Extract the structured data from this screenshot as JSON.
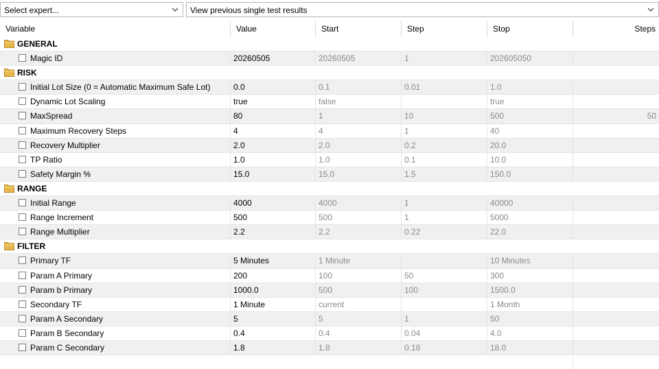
{
  "toolbar": {
    "expert_select": "Select expert...",
    "results_select": "View previous single test results"
  },
  "columns": [
    "Variable",
    "Value",
    "Start",
    "Step",
    "Stop",
    "Steps"
  ],
  "groups": [
    {
      "title": "GENERAL",
      "rows": [
        {
          "name": "Magic ID",
          "value": "20260505",
          "start": "20260505",
          "step": "1",
          "stop": "202605050",
          "steps": ""
        }
      ]
    },
    {
      "title": "RISK",
      "rows": [
        {
          "name": "Initial Lot Size (0 = Automatic Maximum Safe Lot)",
          "value": "0.0",
          "start": "0.1",
          "step": "0.01",
          "stop": "1.0",
          "steps": ""
        },
        {
          "name": "Dynamic Lot Scaling",
          "value": "true",
          "start": "false",
          "step": "",
          "stop": "true",
          "steps": ""
        },
        {
          "name": "MaxSpread",
          "value": "80",
          "start": "1",
          "step": "10",
          "stop": "500",
          "steps": "50"
        },
        {
          "name": "Maximum Recovery Steps",
          "value": "4",
          "start": "4",
          "step": "1",
          "stop": "40",
          "steps": ""
        },
        {
          "name": "Recovery Multiplier",
          "value": "2.0",
          "start": "2.0",
          "step": "0.2",
          "stop": "20.0",
          "steps": ""
        },
        {
          "name": "TP Ratio",
          "value": "1.0",
          "start": "1.0",
          "step": "0.1",
          "stop": "10.0",
          "steps": ""
        },
        {
          "name": "Safety Margin %",
          "value": "15.0",
          "start": "15.0",
          "step": "1.5",
          "stop": "150.0",
          "steps": ""
        }
      ]
    },
    {
      "title": "RANGE",
      "rows": [
        {
          "name": "Initial Range",
          "value": "4000",
          "start": "4000",
          "step": "1",
          "stop": "40000",
          "steps": ""
        },
        {
          "name": "Range Increment",
          "value": "500",
          "start": "500",
          "step": "1",
          "stop": "5000",
          "steps": ""
        },
        {
          "name": "Range Multiplier",
          "value": "2.2",
          "start": "2.2",
          "step": "0.22",
          "stop": "22.0",
          "steps": ""
        }
      ]
    },
    {
      "title": "FILTER",
      "rows": [
        {
          "name": "Primary TF",
          "value": "5 Minutes",
          "start": "1 Minute",
          "step": "",
          "stop": "10 Minutes",
          "steps": ""
        },
        {
          "name": "Param A Primary",
          "value": "200",
          "start": "100",
          "step": "50",
          "stop": "300",
          "steps": ""
        },
        {
          "name": "Param b Primary",
          "value": "1000.0",
          "start": "500",
          "step": "100",
          "stop": "1500.0",
          "steps": ""
        },
        {
          "name": "Secondary TF",
          "value": "1 Minute",
          "start": "current",
          "step": "",
          "stop": "1 Month",
          "steps": ""
        },
        {
          "name": "Param A Secondary",
          "value": "5",
          "start": "5",
          "step": "1",
          "stop": "50",
          "steps": ""
        },
        {
          "name": "Param B Secondary",
          "value": "0.4",
          "start": "0.4",
          "step": "0.04",
          "stop": "4.0",
          "steps": ""
        },
        {
          "name": "Param C Secondary",
          "value": "1.8",
          "start": "1.8",
          "step": "0.18",
          "stop": "18.0",
          "steps": ""
        }
      ]
    }
  ],
  "colors": {
    "folder": "#e8b84a",
    "grid": "#e4e4e4",
    "alt_row": "#f0f0f0",
    "dim_text": "#8a8a8a"
  }
}
